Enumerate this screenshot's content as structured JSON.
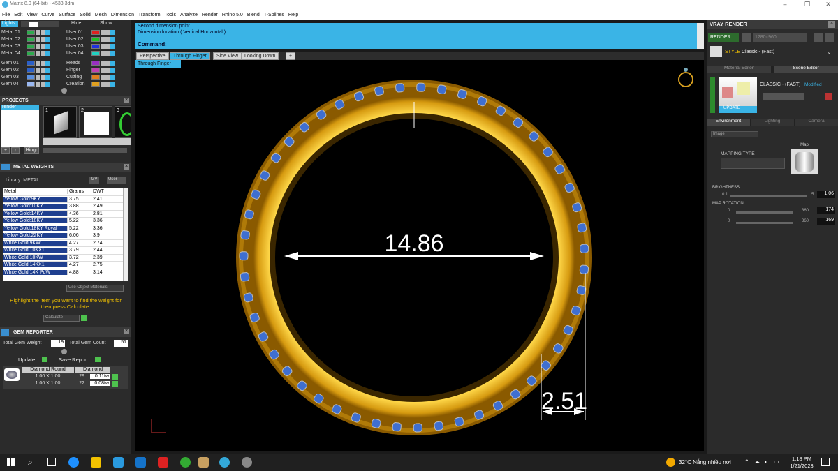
{
  "window": {
    "title": "Matrix 8.0 (64-bit) - 4533.3dm"
  },
  "menu": [
    "File",
    "Edit",
    "View",
    "Curve",
    "Surface",
    "Solid",
    "Mesh",
    "Dimension",
    "Transform",
    "Tools",
    "Analyze",
    "Render",
    "Rhino 5.0",
    "Blend",
    "T-Splines",
    "Help"
  ],
  "layers": {
    "lights_label": "Lights",
    "hide_label": "Hide",
    "show_label": "Show",
    "left": [
      {
        "label": "Metal 01",
        "color": "#2eaa4e"
      },
      {
        "label": "Metal 02",
        "color": "#2eaa4e"
      },
      {
        "label": "Metal 03",
        "color": "#2eaa4e"
      },
      {
        "label": "Metal 04",
        "color": "#2eaa4e"
      },
      {
        "label": "Gem 01",
        "color": "#2a5fc8"
      },
      {
        "label": "Gem 02",
        "color": "#2a5fc8"
      },
      {
        "label": "Gem 03",
        "color": "#5a8fe0"
      },
      {
        "label": "Gem 04",
        "color": "#9ab8f0"
      }
    ],
    "right": [
      {
        "label": "User 01",
        "color": "#e02020"
      },
      {
        "label": "User 02",
        "color": "#20c020"
      },
      {
        "label": "User 03",
        "color": "#2030e0"
      },
      {
        "label": "User 04",
        "color": "#20d0c0"
      },
      {
        "label": "Heads",
        "color": "#9a30c0"
      },
      {
        "label": "Finger",
        "color": "#c040b0"
      },
      {
        "label": "Cutting",
        "color": "#e08020"
      },
      {
        "label": "Creation",
        "color": "#e0a020"
      }
    ]
  },
  "projects": {
    "title": "PROJECTS",
    "list_item": "render",
    "thumbs": [
      "1",
      "2",
      "3"
    ],
    "hinge_label": "Hingr"
  },
  "metal_weights": {
    "title": "METAL WEIGHTS",
    "library_label": "Library: METAL",
    "lib_btn_a": "GV",
    "lib_btn_b": "User",
    "columns": [
      "Metal",
      "Grams",
      "DWT"
    ],
    "rows": [
      [
        "Yellow Gold:9KY",
        "3.75",
        "2.41"
      ],
      [
        "Yellow Gold:10KY",
        "3.88",
        "2.49"
      ],
      [
        "Yellow Gold:14KY",
        "4.36",
        "2.81"
      ],
      [
        "Yellow Gold:18KY",
        "5.22",
        "3.36"
      ],
      [
        "Yellow Gold:18KY Royal",
        "5.22",
        "3.36"
      ],
      [
        "Yellow Gold:22KY",
        "6.06",
        "3.9"
      ],
      [
        "White Gold:9KW",
        "4.27",
        "2.74"
      ],
      [
        "White Gold:10KX1",
        "3.79",
        "2.44"
      ],
      [
        "White Gold:10KW",
        "3.72",
        "2.39"
      ],
      [
        "White Gold:14KX1",
        "4.27",
        "2.75"
      ],
      [
        "White Gold:14K PdW",
        "4.88",
        "3.14"
      ]
    ],
    "use_object_materials": "Use Object Materials",
    "hint": "Highlight the item you want to find the weight for then press Calculate.",
    "calculate_label": "Calculate"
  },
  "gem_reporter": {
    "title": "GEM REPORTER",
    "total_weight_label": "Total Gem Weight",
    "total_weight_value": "19",
    "total_count_label": "Total Gem Count",
    "total_count_value": "51",
    "update_label": "Update",
    "save_report_label": "Save Report",
    "columns": [
      "Diamond Round",
      "Diamond"
    ],
    "rows": [
      [
        "1.00 X 1.00",
        "29",
        "0.11tw"
      ],
      [
        "1.00 X 1.00",
        "22",
        "0.08tw"
      ]
    ]
  },
  "command": {
    "line1": "Second dimension point.",
    "line2": "Dimension location ( Vertical  Horizontal )",
    "prompt": "Command:"
  },
  "viewport_tabs": [
    "Perspective",
    "Through Finger",
    "Side View",
    "Looking Down"
  ],
  "active_tab": "Through Finger",
  "viewport": {
    "label": "Through Finger",
    "dim_inner": "14.86",
    "dim_width": "2.51",
    "ring_color": "#e8b21c",
    "gem_color": "#3f6fd0"
  },
  "vray": {
    "title": "VRAY RENDER",
    "render_label": "RENDER",
    "resolution": "1280x960",
    "style_label": "STYLE",
    "style_value": "Classic - (Fast)",
    "editor_tabs": [
      "Material Editor",
      "Scene Editor"
    ],
    "scene_name": "CLASSIC - (FAST)",
    "modified": "Modified",
    "update_label": "UPDATE",
    "env_tabs": [
      "Environment",
      "Lighting",
      "Camera"
    ],
    "image_label": "Image",
    "mapping_type": "MAPPING TYPE",
    "map_label": "Map",
    "brightness_label": "BRIGHTNESS",
    "brightness_min": "0.1",
    "brightness_max": "5",
    "brightness_value": "1.06",
    "map_rotation_label": "MAP ROTATION",
    "rot_min": "0",
    "rot_max": "360",
    "rot1_value": "174",
    "rot2_value": "169"
  },
  "taskbar": {
    "weather": "32°C  Nắng nhiều nơi",
    "time": "1:18 PM",
    "date": "1/21/2023"
  }
}
